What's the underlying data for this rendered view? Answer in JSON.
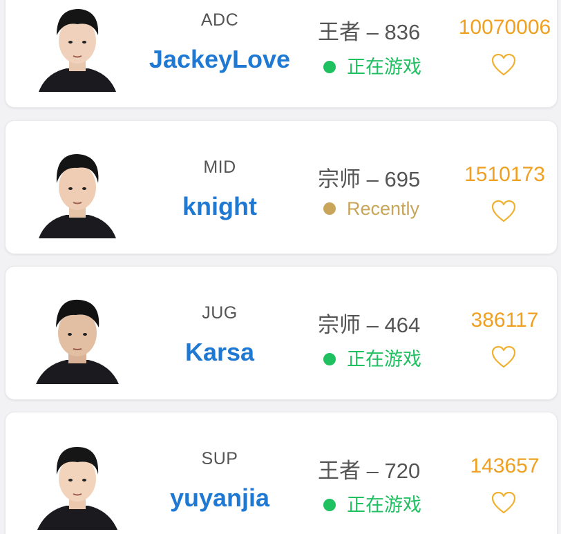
{
  "players": [
    {
      "role": "ADC",
      "name": "JackeyLove",
      "rank": "王者 – 836",
      "status": "正在游戏",
      "status_color": "#1fc060",
      "likes": "10070006",
      "heart_icon": "heart-outline-icon"
    },
    {
      "role": "MID",
      "name": "knight",
      "rank": "宗师 – 695",
      "status": "Recently",
      "status_color": "#c8a55a",
      "likes": "1510173",
      "heart_icon": "heart-outline-icon"
    },
    {
      "role": "JUG",
      "name": "Karsa",
      "rank": "宗师 – 464",
      "status": "正在游戏",
      "status_color": "#1fc060",
      "likes": "386117",
      "heart_icon": "heart-outline-icon"
    },
    {
      "role": "SUP",
      "name": "yuyanjia",
      "rank": "王者 – 720",
      "status": "正在游戏",
      "status_color": "#1fc060",
      "likes": "143657",
      "heart_icon": "heart-outline-icon"
    }
  ],
  "colors": {
    "name": "#1f78d1",
    "likes": "#f0a020",
    "heart": "#f0b030",
    "playing": "#1fc060",
    "recent": "#c8a55a"
  }
}
